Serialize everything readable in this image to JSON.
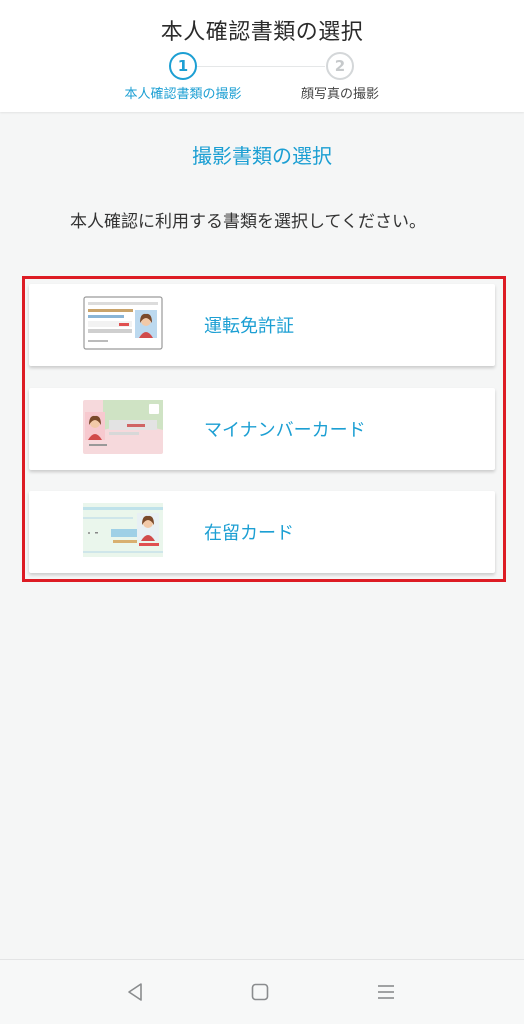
{
  "header": {
    "title": "本人確認書類の選択",
    "steps": [
      {
        "number": "1",
        "label": "本人確認書類の撮影",
        "state": "active"
      },
      {
        "number": "2",
        "label": "顔写真の撮影",
        "state": "inactive"
      }
    ]
  },
  "main": {
    "section_title": "撮影書類の選択",
    "instruction": "本人確認に利用する書類を選択してください。",
    "documents": [
      {
        "label": "運転免許証",
        "icon": "drivers-license-card-icon"
      },
      {
        "label": "マイナンバーカード",
        "icon": "my-number-card-icon"
      },
      {
        "label": "在留カード",
        "icon": "residence-card-icon"
      }
    ]
  },
  "navbar": {
    "back_icon": "back-triangle-icon",
    "home_icon": "home-square-icon",
    "menu_icon": "menu-lines-icon"
  },
  "colors": {
    "accent": "#1c9fd3",
    "highlight_frame": "#dd1c24",
    "background": "#f5f6f6"
  }
}
